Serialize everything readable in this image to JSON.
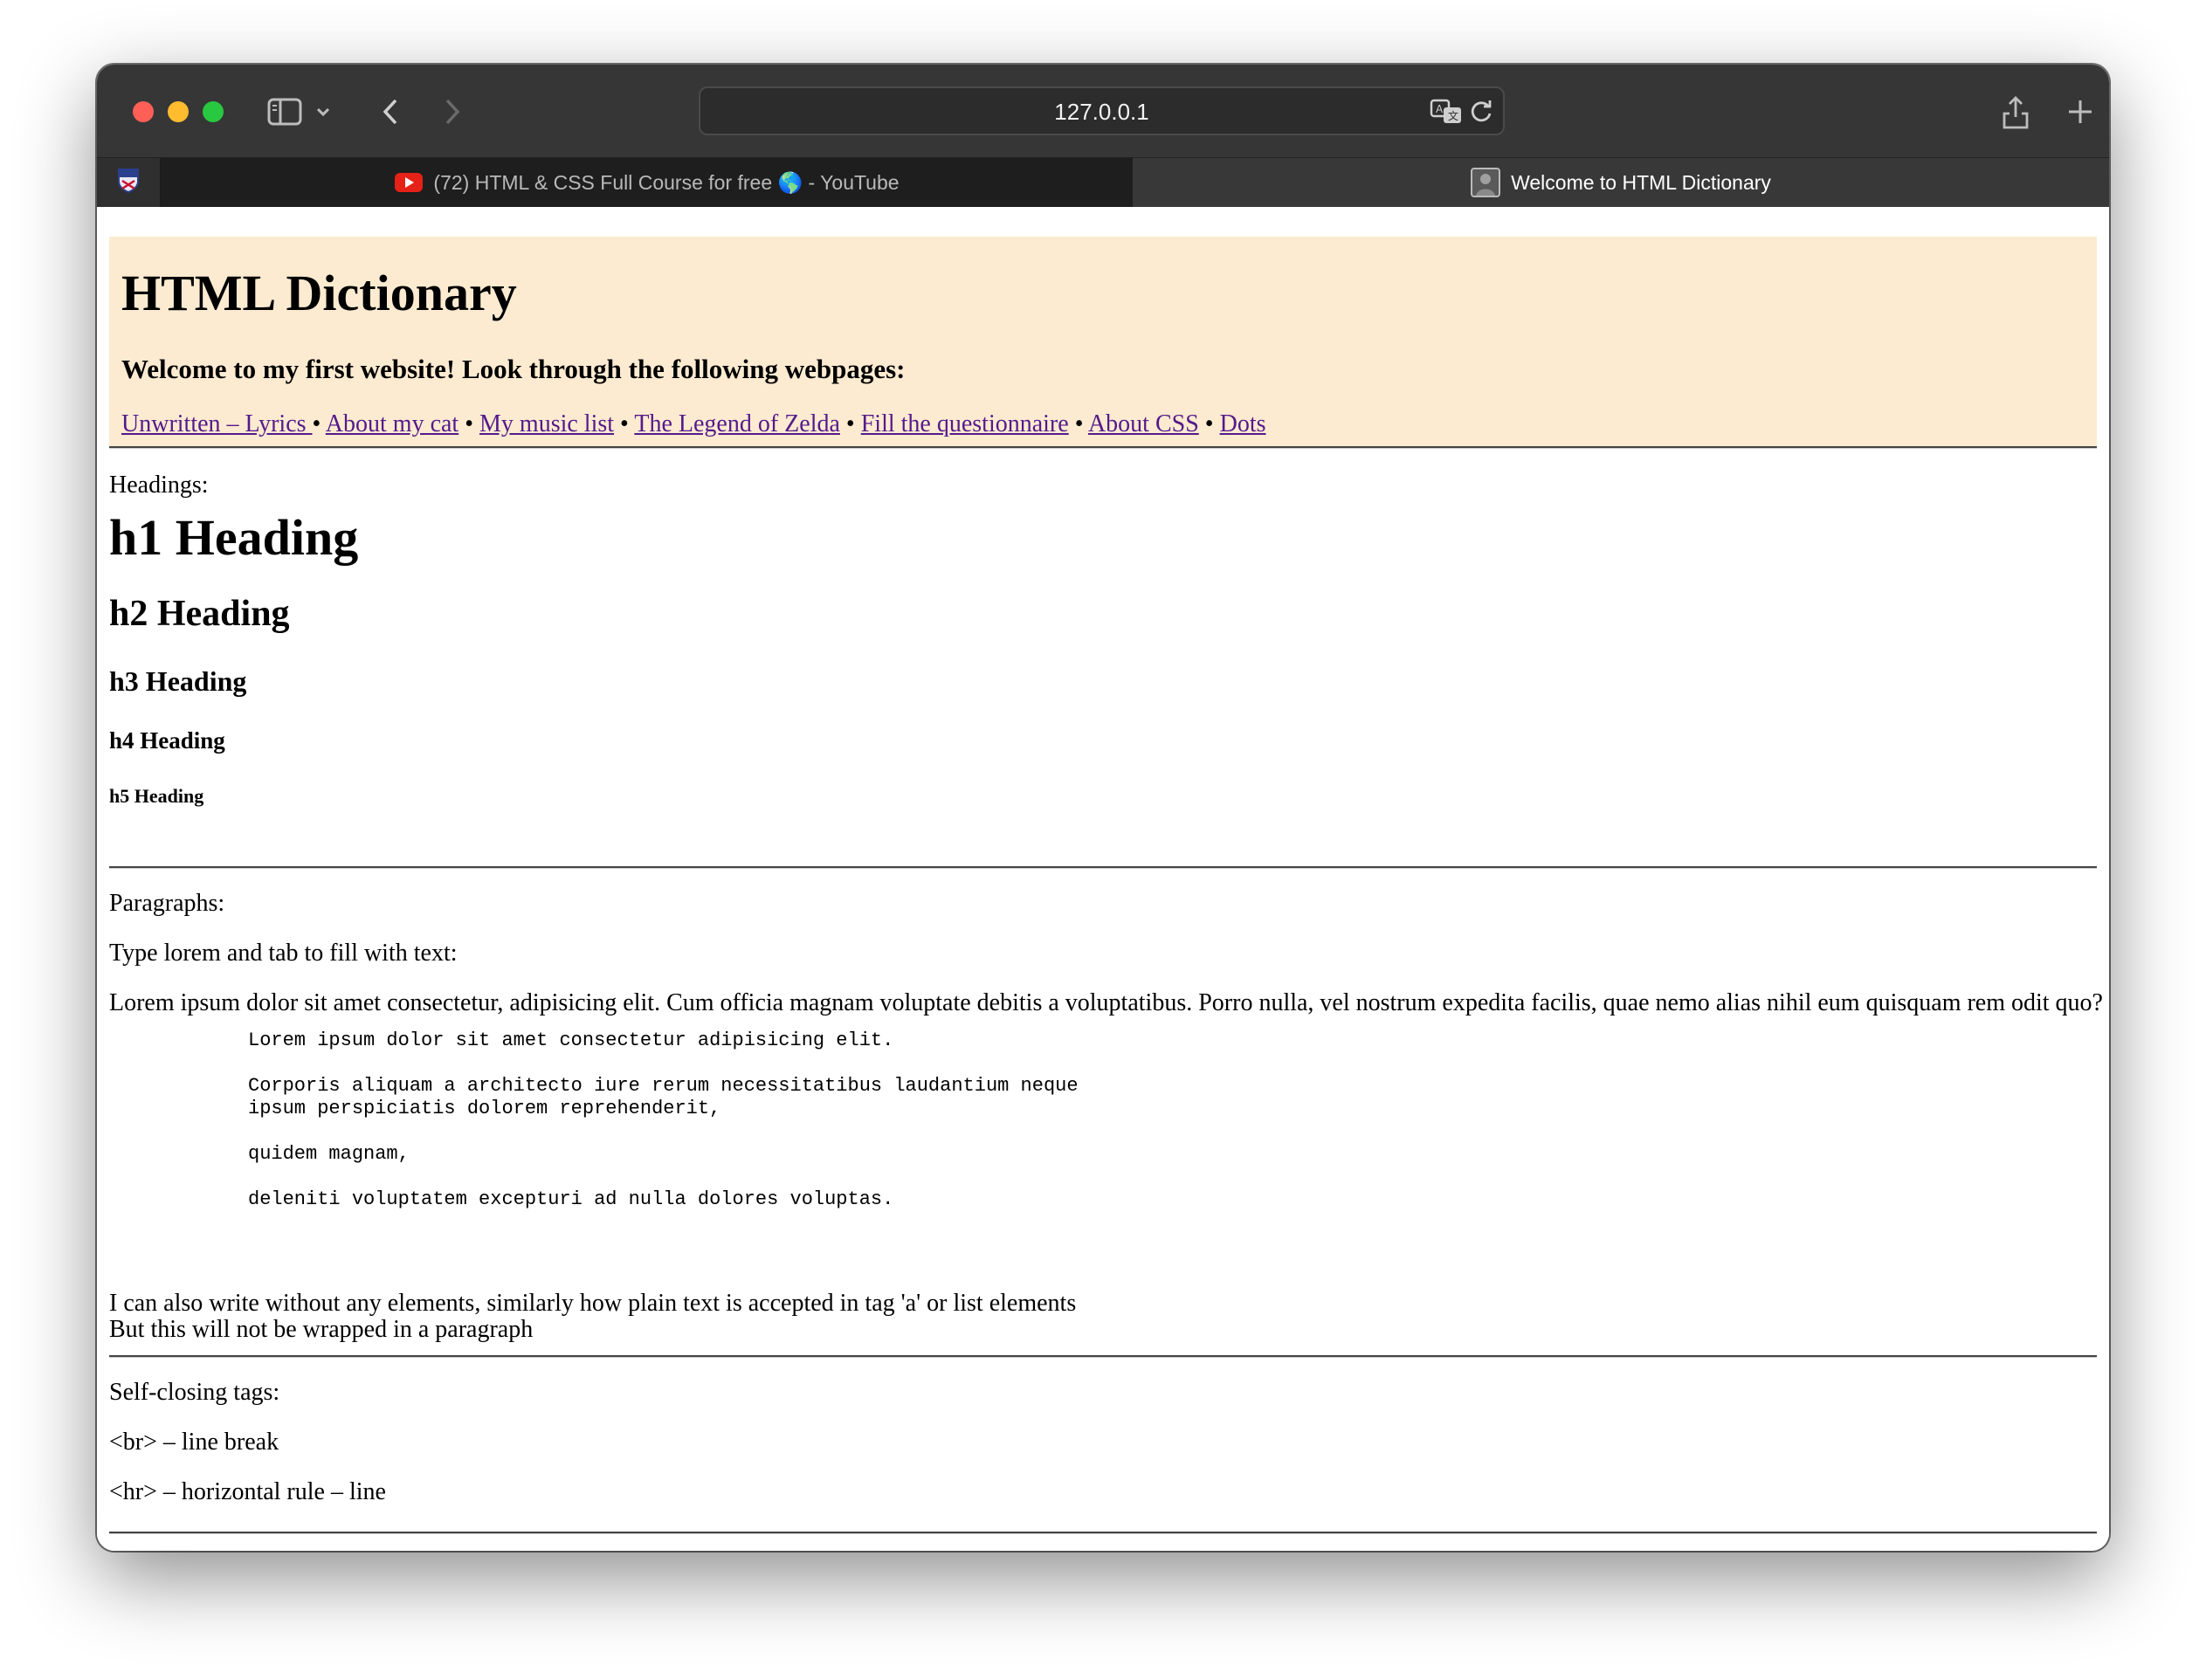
{
  "browser": {
    "url": "127.0.0.1",
    "tabs": [
      {
        "title": "(72) HTML & CSS Full Course for free 🌎 - YouTube",
        "active": false
      },
      {
        "title": "Welcome to HTML Dictionary",
        "active": true
      }
    ]
  },
  "page": {
    "title": "HTML Dictionary",
    "welcome": "Welcome to my first website! Look through the following webpages:",
    "nav_links": [
      "Unwritten – Lyrics ",
      "About my cat",
      "My music list",
      "The Legend of Zelda",
      "Fill the questionnaire",
      "About CSS",
      "Dots"
    ],
    "nav_separator": " • ",
    "headings_label": "Headings:",
    "h1": "h1 Heading",
    "h2": "h2 Heading",
    "h3": "h3 Heading",
    "h4": "h4 Heading",
    "h5": "h5 Heading",
    "paragraphs_label": "Paragraphs:",
    "lorem_hint": "Type lorem and tab to fill with text:",
    "lorem_paragraph": "Lorem ipsum dolor sit amet consectetur, adipisicing elit. Cum officia magnam voluptate debitis a voluptatibus. Porro nulla, vel nostrum expedita facilis, quae nemo alias nihil eum quisquam rem odit quo?",
    "pre_lines": [
      "Lorem ipsum dolor sit amet consectetur adipisicing elit.",
      "Corporis aliquam a architecto iure rerum necessitatibus laudantium neque\nipsum perspiciatis dolorem reprehenderit,",
      "quidem magnam,",
      "deleniti voluptatem excepturi ad nulla dolores voluptas."
    ],
    "plain_line1": "I can also write without any elements, similarly how plain text is accepted in tag 'a' or list elements",
    "plain_line2": "But this will not be wrapped in a paragraph",
    "self_closing_label": "Self-closing tags:",
    "br_desc": "<br> – line break",
    "hr_desc": "<hr> – horizontal rule – line"
  },
  "colors": {
    "header_bg": "#fcebd1",
    "link": "#551a8b",
    "toolbar": "#363636"
  },
  "icons": [
    "sidebar-icon",
    "chevron-down-icon",
    "back-arrow-icon",
    "forward-arrow-icon",
    "translate-icon",
    "reload-icon",
    "share-icon",
    "new-tab-icon",
    "tab-overview-icon",
    "youtube-favicon",
    "site-favicon",
    "university-crest-favicon"
  ]
}
